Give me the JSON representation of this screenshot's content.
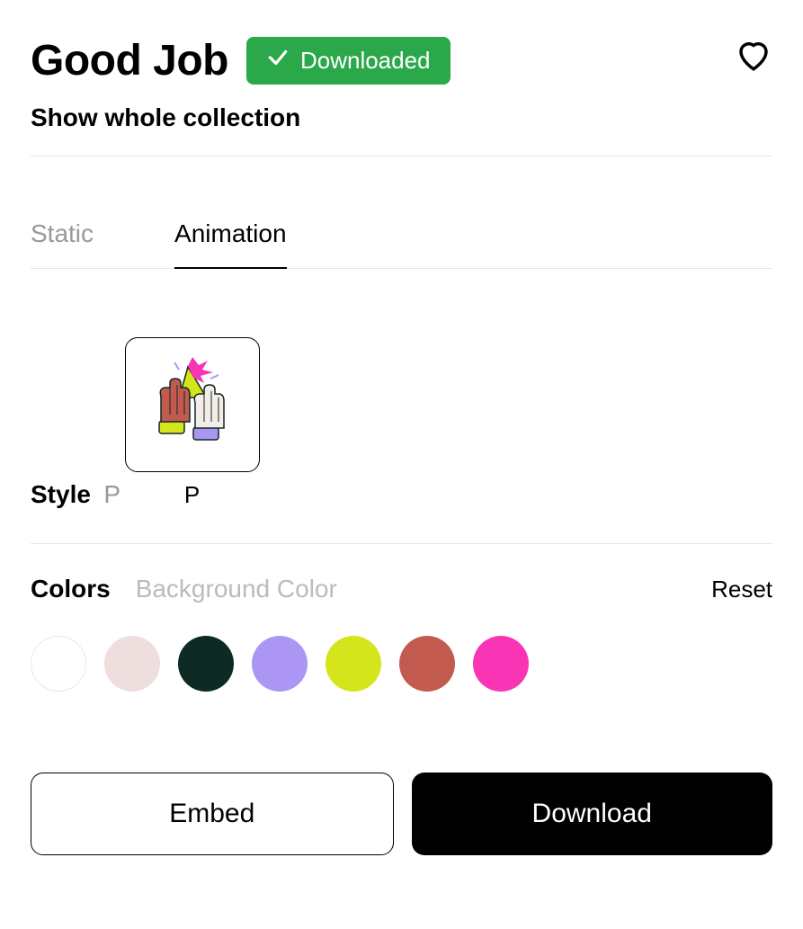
{
  "header": {
    "title": "Good Job",
    "badge_label": "Downloaded",
    "collection_link": "Show whole collection"
  },
  "tabs": {
    "static": "Static",
    "animation": "Animation"
  },
  "style": {
    "label": "Style",
    "value": "P",
    "thumb_label": "P"
  },
  "colors": {
    "label": "Colors",
    "bg_label": "Background Color",
    "reset": "Reset",
    "swatches": [
      {
        "hex": "#ffffff",
        "bordered": true
      },
      {
        "hex": "#eedede",
        "bordered": false
      },
      {
        "hex": "#0e2a24",
        "bordered": false
      },
      {
        "hex": "#ab97f3",
        "bordered": false
      },
      {
        "hex": "#d4e61b",
        "bordered": false
      },
      {
        "hex": "#c25a50",
        "bordered": false
      },
      {
        "hex": "#f935b6",
        "bordered": false
      }
    ]
  },
  "actions": {
    "embed": "Embed",
    "download": "Download"
  }
}
